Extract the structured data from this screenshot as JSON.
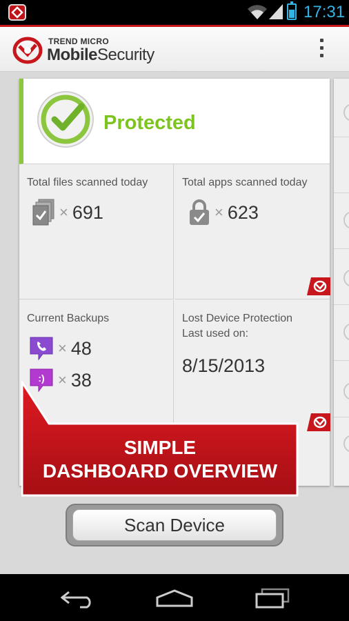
{
  "status_bar": {
    "time": "17:31"
  },
  "header": {
    "brand_top": "TREND MICRO",
    "brand_main_bold": "Mobile",
    "brand_main_light": "Security"
  },
  "status": {
    "text": "Protected"
  },
  "stats": {
    "files": {
      "label": "Total files scanned today",
      "multiplier": "×",
      "value": "691"
    },
    "apps": {
      "label": "Total apps scanned today",
      "multiplier": "×",
      "value": "623"
    },
    "backups": {
      "label": "Current Backups",
      "contacts": {
        "multiplier": "×",
        "value": "48"
      },
      "messages": {
        "multiplier": "×",
        "value": "38"
      }
    },
    "lost_device": {
      "label_line1": "Lost Device Protection",
      "label_line2": "Last used on:",
      "date": "8/15/2013"
    }
  },
  "callout": {
    "line1": "SIMPLE",
    "line2": "DASHBOARD OVERVIEW"
  },
  "scan_button": {
    "label": "Scan Device"
  },
  "colors": {
    "brand_red": "#c8161d",
    "protected_green": "#7dc41f",
    "status_blue": "#33b5e5"
  }
}
